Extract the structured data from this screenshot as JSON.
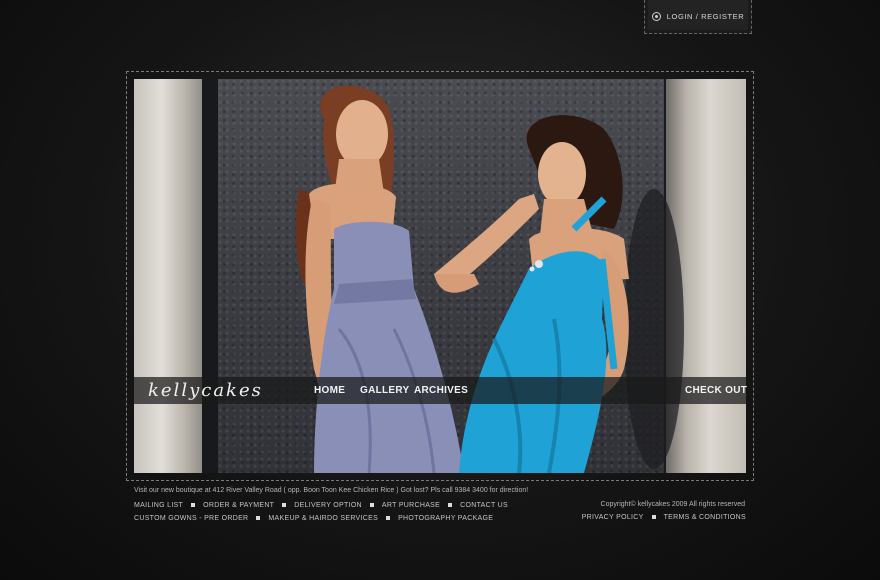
{
  "header": {
    "login_label": "LOGIN / REGISTER"
  },
  "hero": {
    "logo_text": "kellycakes",
    "nav": {
      "home": "HOME",
      "gallery": "GALLERY",
      "archives": "ARCHIVES",
      "checkout": "CHECK OUT"
    }
  },
  "footer": {
    "visit_text": "Visit our new boutique at 412 River Valley Road ( opp. Boon Toon Kee Chicken Rice ) Got lost? Pls call 9384 3400 for direction!",
    "links_row1": [
      "MAILING LIST",
      "ORDER & PAYMENT",
      "DELIVERY OPTION",
      "ART PURCHASE",
      "CONTACT US"
    ],
    "links_row2": [
      "CUSTOM GOWNS - PRE ORDER",
      "MAKEUP & HAIRDO SERVICES",
      "PHOTOGRAPHY PACKAGE"
    ],
    "copyright": "Copyright© kellycakes 2009 All rights reserved",
    "legal": [
      "PRIVACY POLICY",
      "TERMS & CONDITIONS"
    ]
  },
  "colors": {
    "background": "#151515",
    "dress_left": "#8a8fb8",
    "dress_right": "#1fa3d6"
  }
}
